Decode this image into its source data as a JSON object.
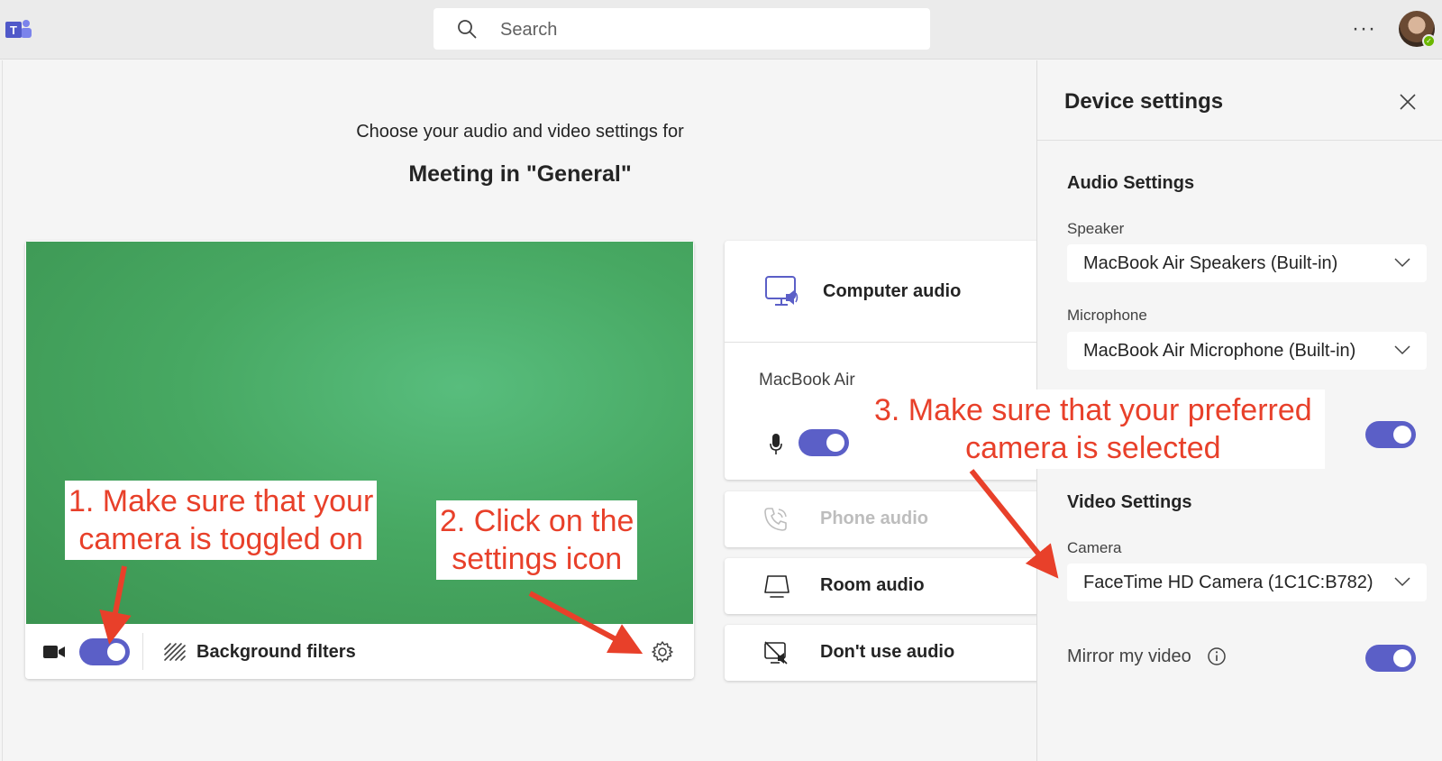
{
  "topbar": {
    "search_placeholder": "Search",
    "more_label": "···"
  },
  "main": {
    "choose_text": "Choose your audio and video settings for",
    "meeting_title": "Meeting in \"General\"",
    "video": {
      "camera_toggle_on": true,
      "background_filters_label": "Background filters"
    },
    "audio_options": [
      {
        "label": "Computer audio",
        "icon": "computer-audio-icon",
        "selected": true,
        "device_label": "MacBook Air"
      },
      {
        "label": "Phone audio",
        "icon": "phone-audio-icon",
        "disabled": true
      },
      {
        "label": "Room audio",
        "icon": "room-audio-icon"
      },
      {
        "label": "Don't use audio",
        "icon": "no-audio-icon"
      }
    ]
  },
  "panel": {
    "title": "Device settings",
    "audio_settings_title": "Audio Settings",
    "speaker_label": "Speaker",
    "speaker_value": "MacBook Air Speakers (Built-in)",
    "microphone_label": "Microphone",
    "microphone_value": "MacBook Air Microphone (Built-in)",
    "video_settings_title": "Video Settings",
    "camera_label": "Camera",
    "camera_value": "FaceTime HD Camera (1C1C:B782)",
    "mirror_label": "Mirror my video"
  },
  "annotations": {
    "step1_line1": "1. Make sure that your",
    "step1_line2": "camera is toggled on",
    "step2_line1": "2. Click on the",
    "step2_line2": "settings icon",
    "step3_line1": "3. Make sure that your preferred",
    "step3_line2": "camera is selected"
  },
  "colors": {
    "accent": "#5b5fc7",
    "annotation": "#e8402a",
    "video_bg": "#47a862"
  }
}
